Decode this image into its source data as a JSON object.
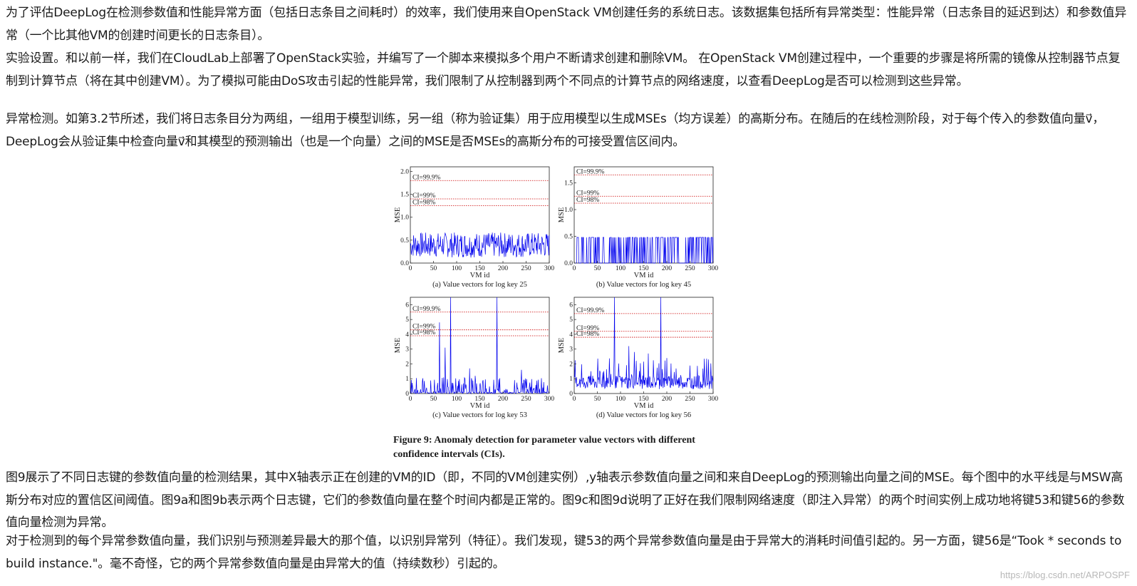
{
  "paragraphs": {
    "p1": "为了评估DeepLog在检测参数值和性能异常方面（包括日志条目之间耗时）的效率，我们使用来自OpenStack VM创建任务的系统日志。该数据集包括所有异常类型：性能异常（日志条目的延迟到达）和参数值异常（一个比其他VM的创建时间更长的日志条目）。",
    "p2": "实验设置。和以前一样，我们在CloudLab上部署了OpenStack实验，并编写了一个脚本来模拟多个用户不断请求创建和删除VM。 在OpenStack VM创建过程中，一个重要的步骤是将所需的镜像从控制器节点复制到计算节点（将在其中创建VM）。为了模拟可能由DoS攻击引起的性能异常，我们限制了从控制器到两个不同点的计算节点的网络速度，以查看DeepLog是否可以检测到这些异常。",
    "p3": "异常检测。如第3.2节所述，我们将日志条目分为两组，一组用于模型训练，另一组（称为验证集）用于应用模型以生成MSEs（均方误差）的高斯分布。在随后的在线检测阶段，对于每个传入的参数值向量v⃗，DeepLog会从验证集中检查向量v⃗和其模型的预测输出（也是一个向量）之间的MSE是否MSEs的高斯分布的可接受置信区间内。",
    "p4": "图9展示了不同日志键的参数值向量的检测结果，其中X轴表示正在创建的VM的ID（即，不同的VM创建实例）,y轴表示参数值向量之间和来自DeepLog的预测输出向量之间的MSE。每个图中的水平线是与MSW高斯分布对应的置信区间阈值。图9a和图9b表示两个日志键，它们的参数值向量在整个时间内都是正常的。图9c和图9d说明了正好在我们限制网络速度（即注入异常）的两个时间实例上成功地将键53和键56的参数值向量检测为异常。",
    "p5": "对于检测到的每个异常参数值向量，我们识别与预测差异最大的那个值，以识别异常列（特征）。我们发现，键53的两个异常参数值向量是由于异常大的消耗时间值引起的。另一方面，键56是“Took * seconds to build instance.\"。毫不奇怪，它的两个异常参数值向量是由异常大的值（持续数秒）引起的。"
  },
  "figure": {
    "caption": "Figure 9: Anomaly detection for parameter value vectors with different confidence intervals (CIs)."
  },
  "watermark": "https://blog.csdn.net/ARPOSPF",
  "colors": {
    "series": "#0000ee",
    "threshold": "#cc0000",
    "text": "#1a1a1a"
  },
  "chart_data": [
    {
      "type": "line",
      "title": "(a) Value vectors for log key 25",
      "xlabel": "VM id",
      "ylabel": "MSE",
      "xlim": [
        0,
        300
      ],
      "ylim": [
        0,
        2.1
      ],
      "xticks": [
        0,
        50,
        100,
        150,
        200,
        250,
        300
      ],
      "yticks": [
        0,
        0.5,
        1.0,
        1.5,
        2.0
      ],
      "yticklabels": [
        "0.0",
        "0.5",
        "1.0",
        "1.5",
        "2.0"
      ],
      "thresholds": [
        {
          "name": "CI=99.9%",
          "value": 1.8
        },
        {
          "name": "CI=99%",
          "value": 1.4
        },
        {
          "name": "CI=98%",
          "value": 1.25
        }
      ],
      "series": [
        {
          "pattern": "noise",
          "base": 0.12,
          "amp": 0.55,
          "spikes": []
        }
      ]
    },
    {
      "type": "line",
      "title": "(b) Value vectors for log key 45",
      "xlabel": "VM id",
      "ylabel": "MSE",
      "xlim": [
        0,
        300
      ],
      "ylim": [
        0,
        1.8
      ],
      "xticks": [
        0,
        50,
        100,
        150,
        200,
        250,
        300
      ],
      "yticks": [
        0,
        0.5,
        1.0,
        1.5
      ],
      "yticklabels": [
        "0.0",
        "0.5",
        "1.0",
        "1.5"
      ],
      "thresholds": [
        {
          "name": "CI=99.9%",
          "value": 1.65
        },
        {
          "name": "CI=99%",
          "value": 1.25
        },
        {
          "name": "CI=98%",
          "value": 1.12
        }
      ],
      "series": [
        {
          "pattern": "square",
          "base": 0.0,
          "amp": 0.48,
          "spikes": []
        }
      ]
    },
    {
      "type": "line",
      "title": "(c) Value vectors for log key 53",
      "xlabel": "VM id",
      "ylabel": "MSE",
      "xlim": [
        0,
        300
      ],
      "ylim": [
        0,
        6.5
      ],
      "xticks": [
        0,
        50,
        100,
        150,
        200,
        250,
        300
      ],
      "yticks": [
        0,
        1,
        2,
        3,
        4,
        5,
        6
      ],
      "yticklabels": [
        "0",
        "1",
        "2",
        "3",
        "4",
        "5",
        "6"
      ],
      "thresholds": [
        {
          "name": "CI=99.9%",
          "value": 5.5
        },
        {
          "name": "CI=99%",
          "value": 4.3
        },
        {
          "name": "CI=98%",
          "value": 3.9
        }
      ],
      "series": [
        {
          "pattern": "sparse",
          "base": 0.1,
          "amp": 0.5,
          "spikes": [
            [
              63,
              4.8
            ],
            [
              75,
              3.1
            ],
            [
              87,
              6.5
            ],
            [
              187,
              6.5
            ],
            [
              128,
              1.7
            ],
            [
              140,
              1.2
            ],
            [
              240,
              1.6
            ]
          ]
        }
      ]
    },
    {
      "type": "line",
      "title": "(d) Value vectors for log key 56",
      "xlabel": "VM id",
      "ylabel": "MSE",
      "xlim": [
        0,
        300
      ],
      "ylim": [
        0,
        6.5
      ],
      "xticks": [
        0,
        50,
        100,
        150,
        200,
        250,
        300
      ],
      "yticks": [
        0,
        1,
        2,
        3,
        4,
        5,
        6
      ],
      "yticklabels": [
        "0",
        "1",
        "2",
        "3",
        "4",
        "5",
        "6"
      ],
      "thresholds": [
        {
          "name": "CI=99.9%",
          "value": 5.4
        },
        {
          "name": "CI=99%",
          "value": 4.2
        },
        {
          "name": "CI=98%",
          "value": 3.8
        }
      ],
      "series": [
        {
          "pattern": "dense",
          "base": 0.3,
          "amp": 1.3,
          "spikes": [
            [
              87,
              6.5
            ],
            [
              187,
              6.5
            ],
            [
              118,
              3.2
            ],
            [
              130,
              2.8
            ],
            [
              160,
              2.7
            ],
            [
              200,
              2.4
            ],
            [
              290,
              2.3
            ]
          ]
        }
      ]
    }
  ]
}
